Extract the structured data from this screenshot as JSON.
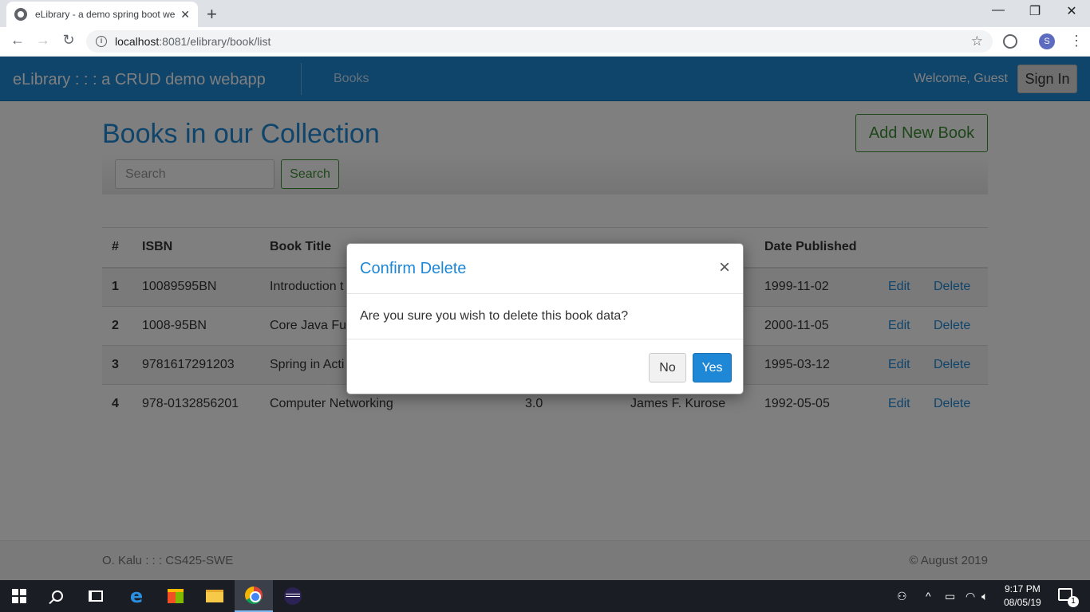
{
  "browser": {
    "tab_title": "eLibrary - a demo spring boot we",
    "tab_close": "✕",
    "new_tab": "+",
    "url_host": "localhost",
    "url_rest": ":8081/elibrary/book/list",
    "profile_initial": "S",
    "window_controls": [
      "—",
      "❐",
      "✕"
    ]
  },
  "navbar": {
    "brand": "eLibrary : : : a CRUD demo webapp",
    "nav_books": "Books",
    "welcome": "Welcome, Guest",
    "signin": "Sign In",
    "color": "#1e88d6"
  },
  "main": {
    "heading": "Books in our Collection",
    "add_button": "Add New Book",
    "search_placeholder": "Search",
    "search_button": "Search"
  },
  "table": {
    "headers": [
      "#",
      "ISBN",
      "Book Title",
      "",
      "",
      "Date Published",
      "",
      ""
    ],
    "rows": [
      {
        "num": "1",
        "isbn": "10089595BN",
        "title": "Introduction t",
        "edition": "",
        "author": "",
        "date": "1999-11-02",
        "edit": "Edit",
        "delete": "Delete"
      },
      {
        "num": "2",
        "isbn": "1008-95BN",
        "title": "Core Java Fun",
        "edition": "",
        "author": "",
        "date": "2000-11-05",
        "edit": "Edit",
        "delete": "Delete"
      },
      {
        "num": "3",
        "isbn": "9781617291203",
        "title": "Spring in Acti",
        "edition": "",
        "author": "",
        "date": "1995-03-12",
        "edit": "Edit",
        "delete": "Delete"
      },
      {
        "num": "4",
        "isbn": "978-0132856201",
        "title": "Computer Networking",
        "edition": "3.0",
        "author": "James F. Kurose",
        "date": "1992-05-05",
        "edit": "Edit",
        "delete": "Delete"
      }
    ]
  },
  "footer": {
    "left": "O. Kalu : : : CS425-SWE",
    "right": "© August 2019"
  },
  "modal": {
    "title": "Confirm Delete",
    "close": "×",
    "body": "Are you sure you wish to delete this book data?",
    "no": "No",
    "yes": "Yes"
  },
  "taskbar": {
    "time": "9:17 PM",
    "date": "08/05/19",
    "notification_count": "1"
  }
}
